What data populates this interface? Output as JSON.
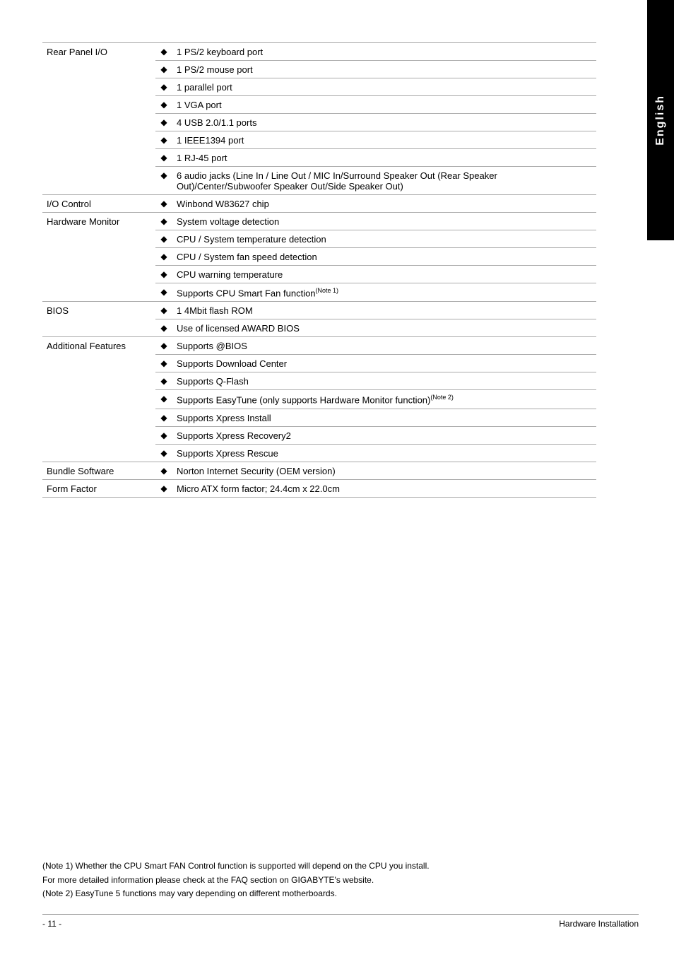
{
  "english_tab": "English",
  "table": {
    "rows": [
      {
        "label": "Rear Panel I/O",
        "items": [
          "1 PS/2 keyboard port",
          "1 PS/2 mouse port",
          "1 parallel port",
          "1 VGA port",
          "4 USB 2.0/1.1 ports",
          "1 IEEE1394 port",
          "1 RJ-45 port",
          "6 audio jacks (Line In / Line Out / MIC In/Surround Speaker Out (Rear Speaker Out)/Center/Subwoofer Speaker Out/Side Speaker Out)"
        ]
      },
      {
        "label": "I/O Control",
        "items": [
          "Winbond W83627 chip"
        ]
      },
      {
        "label": "Hardware Monitor",
        "items": [
          "System voltage detection",
          "CPU / System temperature detection",
          "CPU / System fan speed detection",
          "CPU warning temperature",
          "Supports CPU Smart Fan function(Note 1)"
        ],
        "superscripts": [
          null,
          null,
          null,
          null,
          "Note 1"
        ]
      },
      {
        "label": "BIOS",
        "items": [
          "1 4Mbit flash ROM",
          "Use of licensed AWARD BIOS"
        ]
      },
      {
        "label": "Additional Features",
        "items": [
          "Supports @BIOS",
          "Supports Download Center",
          "Supports Q-Flash",
          "Supports EasyTune (only supports Hardware Monitor function)(Note 2)",
          "Supports Xpress Install",
          "Supports Xpress Recovery2",
          "Supports Xpress Rescue"
        ],
        "superscripts": [
          null,
          null,
          null,
          "Note 2",
          null,
          null,
          null
        ]
      },
      {
        "label": "Bundle Software",
        "items": [
          "Norton Internet Security (OEM version)"
        ]
      },
      {
        "label": "Form Factor",
        "items": [
          "Micro ATX form factor; 24.4cm x 22.0cm"
        ]
      }
    ]
  },
  "notes": [
    "(Note 1) Whether the CPU Smart FAN Control function is supported will depend on the CPU you install.",
    "         For more detailed information please check at the FAQ section on GIGABYTE's website.",
    "(Note 2) EasyTune 5 functions may vary depending on different motherboards."
  ],
  "footer": {
    "page_number": "- 11 -",
    "section": "Hardware Installation"
  }
}
